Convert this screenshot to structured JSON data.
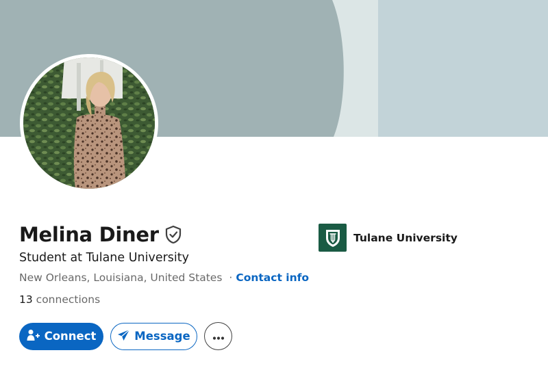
{
  "profile": {
    "name": "Melina Diner",
    "headline": "Student at Tulane University",
    "location": "New Orleans, Louisiana, United States",
    "separator": "·",
    "contact_info_label": "Contact info",
    "connections_count": "13",
    "connections_label": "connections"
  },
  "actions": {
    "connect_label": "Connect",
    "message_label": "Message",
    "more_glyph": "•••"
  },
  "organization": {
    "name": "Tulane University"
  },
  "icons": {
    "verified": "shield-check-icon",
    "connect": "add-person-icon",
    "message": "paper-plane-icon",
    "more": "ellipsis-icon",
    "org_logo": "tulane-shield-logo"
  },
  "colors": {
    "brand_blue": "#0a66c2",
    "banner_dark": "#a0b2b4",
    "banner_light": "#dce6e6",
    "banner_right": "#c2d3d8",
    "tulane_green": "#1a5b44"
  }
}
